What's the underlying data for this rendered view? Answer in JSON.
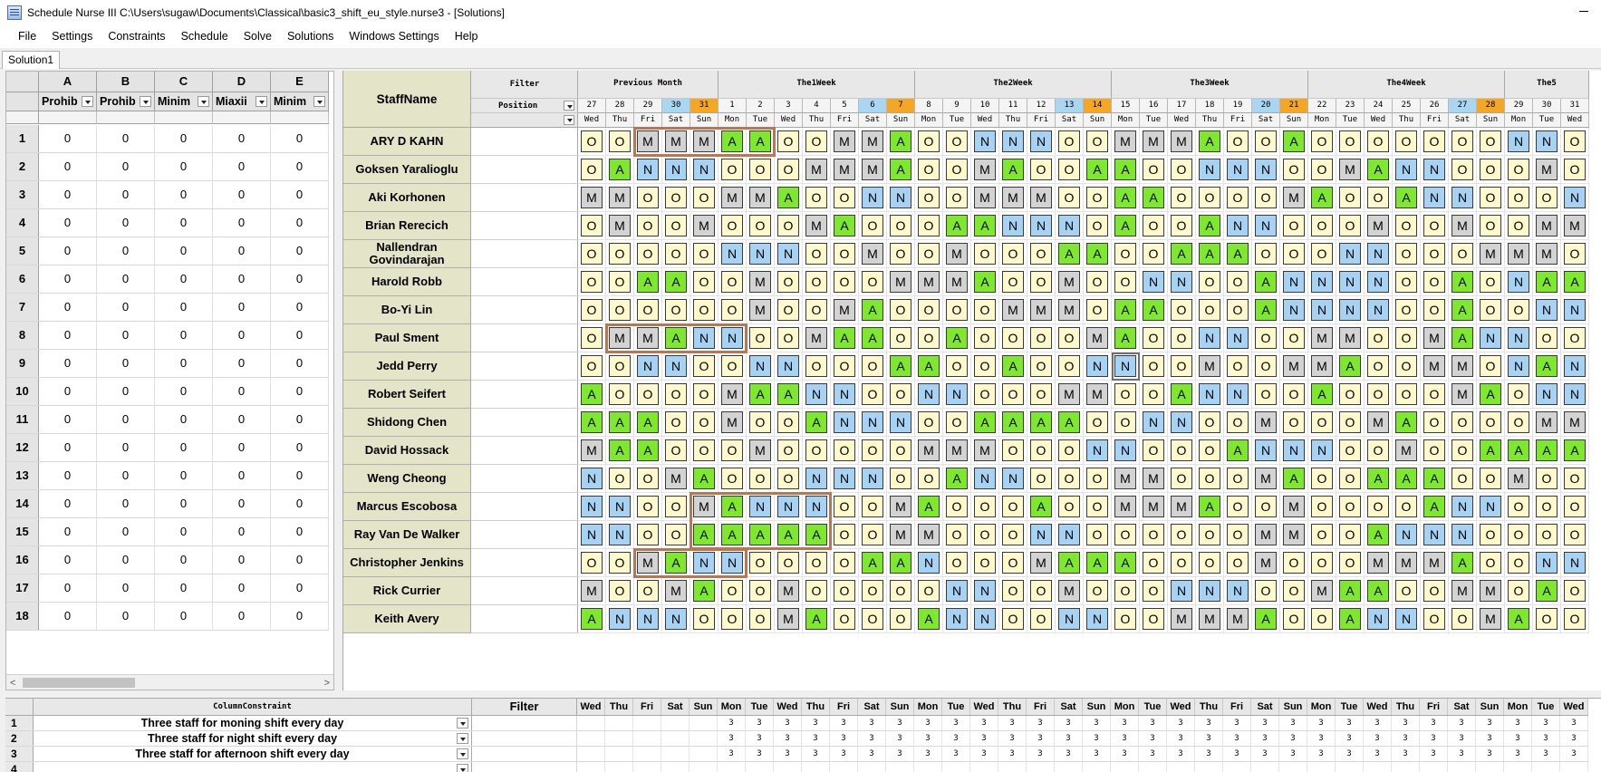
{
  "window": {
    "title": "Schedule Nurse III   C:\\Users\\sugaw\\Documents\\Classical\\basic3_shift_eu_style.nurse3 - [Solutions]"
  },
  "menu": [
    "File",
    "Settings",
    "Constraints",
    "Schedule",
    "Solve",
    "Solutions",
    "Windows Settings",
    "Help"
  ],
  "tab": {
    "label": "Solution1"
  },
  "left_grid": {
    "columns": [
      "A",
      "B",
      "C",
      "D",
      "E"
    ],
    "subheaders": [
      "Prohib",
      "Prohib",
      "Minim",
      "Miaxii",
      "Minim"
    ],
    "row_numbers": [
      "1",
      "2",
      "3",
      "4",
      "5",
      "6",
      "7",
      "8",
      "9",
      "10",
      "11",
      "12",
      "13",
      "14",
      "15",
      "16",
      "17",
      "18"
    ],
    "cell_value": "0"
  },
  "schedule": {
    "staff_header": "StaffName",
    "filter_label": "Filter",
    "position_label": "Position",
    "weeks": [
      "Previous Month",
      "The1Week",
      "The2Week",
      "The3Week",
      "The4Week",
      "The5"
    ],
    "days": [
      "27",
      "28",
      "29",
      "30",
      "31",
      "1",
      "2",
      "3",
      "4",
      "5",
      "6",
      "7",
      "8",
      "9",
      "10",
      "11",
      "12",
      "13",
      "14",
      "15",
      "16",
      "17",
      "18",
      "19",
      "20",
      "21",
      "22",
      "23",
      "24",
      "25",
      "26",
      "27",
      "28",
      "29",
      "30",
      "31"
    ],
    "dow": [
      "Wed",
      "Thu",
      "Fri",
      "Sat",
      "Sun",
      "Mon",
      "Tue",
      "Wed",
      "Thu",
      "Fri",
      "Sat",
      "Sun",
      "Mon",
      "Tue",
      "Wed",
      "Thu",
      "Fri",
      "Sat",
      "Sun",
      "Mon",
      "Tue",
      "Wed",
      "Thu",
      "Fri",
      "Sat",
      "Sun",
      "Mon",
      "Tue",
      "Wed",
      "Thu",
      "Fri",
      "Sat",
      "Sun",
      "Mon",
      "Tue",
      "Wed"
    ],
    "staff": [
      {
        "name": "ARY D KAHN",
        "shifts": "OOMMMAAOOMMAOONNNOOMMMAOOAOOOOOOONNO"
      },
      {
        "name": "Goksen Yaralioglu",
        "shifts": "OANNNOOOMMMAOOMAOOAAOONNNOOMANNOOOMO"
      },
      {
        "name": "Aki Korhonen",
        "shifts": "MMOOOMMAOONNOOMMMOOAAOOOOMAOOANNOOON"
      },
      {
        "name": "Brian Rerecich",
        "shifts": "OMOOMOOOMAOOOAANNNOAOOANNOOOMOOMOOMM"
      },
      {
        "name": "Nallendran Govindarajan",
        "shifts": "OOOOONNNOOMOOMOOOAAOOAAAOOONNOOOMMMO"
      },
      {
        "name": "Harold Robb",
        "shifts": "OOAAOOMOOOOMMMAOOMOONNOOANNNNOOAONAA"
      },
      {
        "name": "Bo-Yi Lin",
        "shifts": "OOOOOOMOOMAOOOOMMMOAAOOOANNNNOOAOONN"
      },
      {
        "name": "Paul Sment",
        "shifts": "OMMANNOOMAAOOAOOOOMAOONNOOMMOOMANNOO"
      },
      {
        "name": "Jedd Perry",
        "shifts": "OONNOONNOOOAAOOAOONNOOMOOMMAOOMMONAN"
      },
      {
        "name": "Robert Seifert",
        "shifts": "AOOOOMAANNOONNOOOMMOOANNOOAOOOOMAONN"
      },
      {
        "name": "Shidong Chen",
        "shifts": "AAAOOMOOANNNOOAAAAOONNOOMOOOMAOOOOMM"
      },
      {
        "name": "David Hossack",
        "shifts": "MAAOOOMOOOOOMMMOOONNOOOANNNOOMOOAAAA"
      },
      {
        "name": "Weng Cheong",
        "shifts": "NOOMAOOONNNOOANNOOOMMOOOMAOOAAAOOMOO"
      },
      {
        "name": "Marcus Escobosa",
        "shifts": "NNOOMANNNOOMAOOOAOOMMMAOOMOOOOANNOOO"
      },
      {
        "name": "Ray Van De Walker",
        "shifts": "NNOOAAAAAOOMMOOONNOOOOOOMMOOANNNOOOO"
      },
      {
        "name": "Christopher Jenkins",
        "shifts": "OOMANNOOOOAANOOOMAAAOOOOMOOOMMMAOONNO"
      },
      {
        "name": "Rick Currier",
        "shifts": "MOOMAOOMOOOOONNOOMOOONNNOOMAAOOMMOAO"
      },
      {
        "name": "Keith Avery",
        "shifts": "ANNNOOOMAOOOANNOONNOOMMMAOOANNOOMAOO"
      }
    ]
  },
  "column_constraints": {
    "header": "ColumnConstraint",
    "filter_label": "Filter",
    "rows": [
      {
        "num": "1",
        "text": "Three staff for moning shift every day",
        "value": "3"
      },
      {
        "num": "2",
        "text": "Three staff for night shift every day",
        "value": "3"
      },
      {
        "num": "3",
        "text": "Three staff for afternoon shift every day",
        "value": "3"
      },
      {
        "num": "4",
        "text": "",
        "value": ""
      }
    ]
  },
  "colors": {
    "O": "#fff9cc",
    "M": "#d3d3d3",
    "A": "#7ee82f",
    "N": "#a6d2f4",
    "sat": "#a9d7f2",
    "sun": "#f5a623",
    "highlight": "#b97751"
  }
}
